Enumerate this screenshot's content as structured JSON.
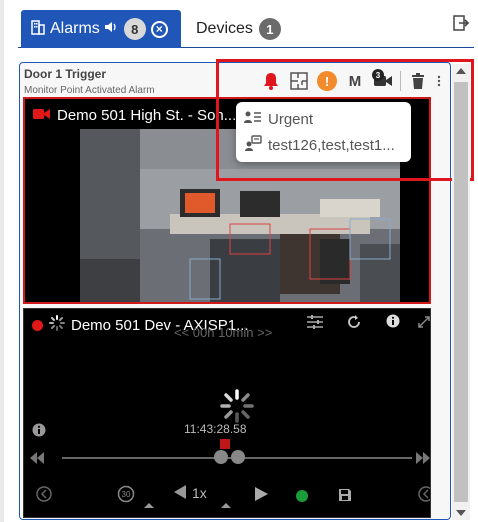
{
  "tabs": {
    "alarms": {
      "label": "Alarms",
      "count": "8"
    },
    "devices": {
      "label": "Devices",
      "count": "1"
    }
  },
  "alarm": {
    "title": "Door 1 Trigger",
    "subtitle": "Monitor Point Activated Alarm",
    "camera_count": "3",
    "priority_marker": "!",
    "m_label": "M"
  },
  "popup": {
    "priority": "Urgent",
    "assignees": "test126,test,test1..."
  },
  "video1": {
    "title": "Demo 501 High St. - Son..."
  },
  "video2": {
    "title": "Demo 501 Dev - AXISP1...",
    "duration": "<< 00h 10min >>",
    "timestamp": "11:43:28.58",
    "speed": "1x",
    "skip": "30"
  },
  "colors": {
    "tab_active": "#1f56b8",
    "highlight": "#e0161e",
    "bell": "#e0161e",
    "urgent": "#f28b2c"
  }
}
